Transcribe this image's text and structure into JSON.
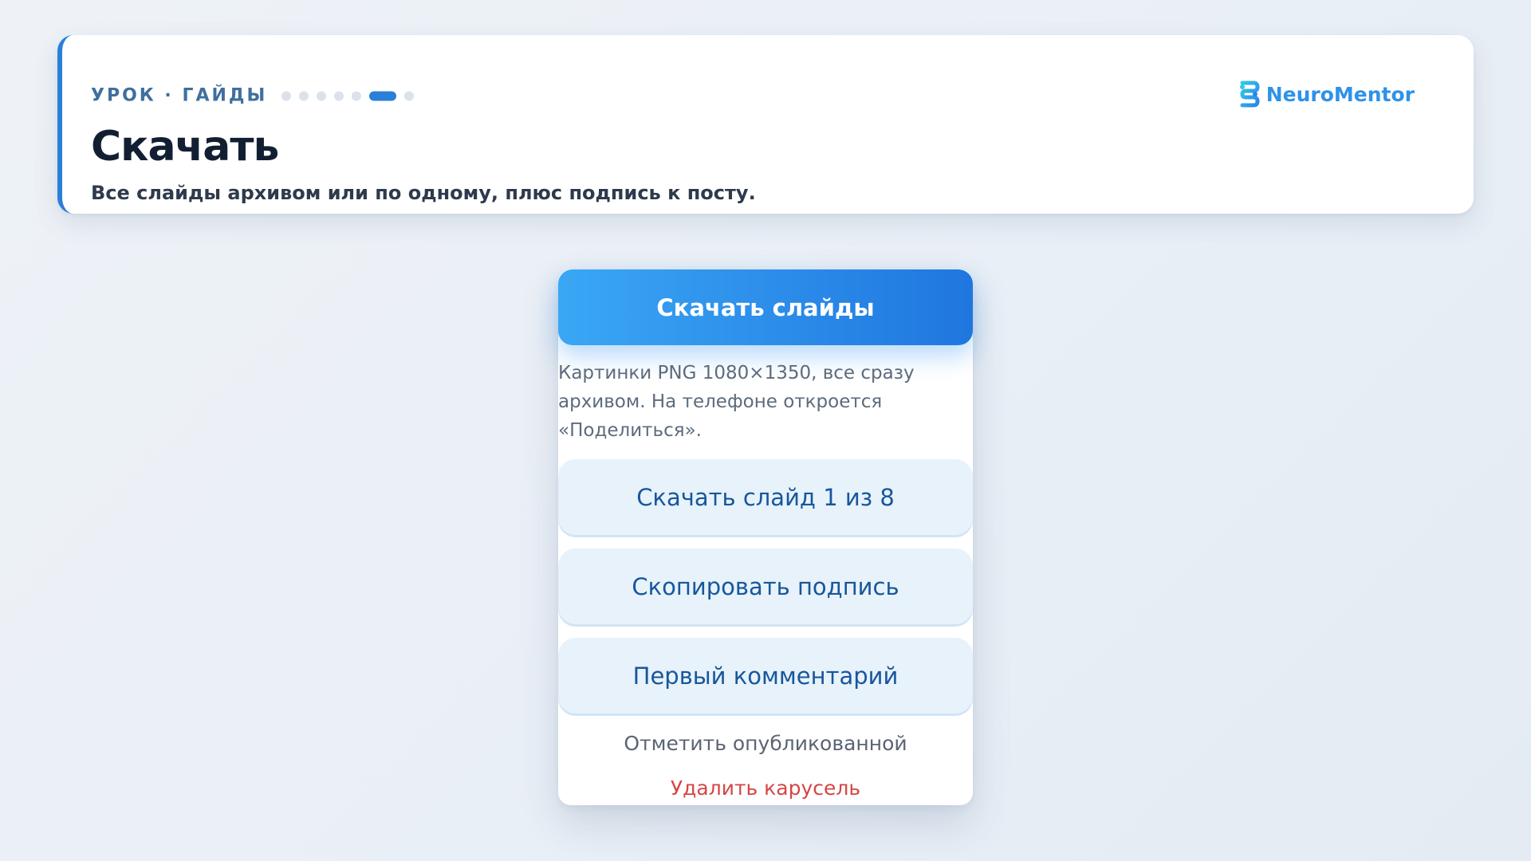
{
  "header": {
    "eyebrow": "УРОК · ГАЙДЫ",
    "progress": {
      "total_steps": 7,
      "current_step": 6
    },
    "title": "Скачать",
    "subtitle": "Все слайды архивом или по одному, плюс подпись к посту."
  },
  "brand": {
    "name": "NeuroMentor",
    "icon": "neuromentor-logo-icon",
    "color": "#2e92e8"
  },
  "actions": {
    "primary_label": "Скачать слайды",
    "hint": "Картинки PNG 1080×1350, все сразу архивом. На телефоне откроется «Поделиться».",
    "download_one_label": "Скачать слайд 1 из 8",
    "copy_caption_label": "Скопировать подпись",
    "first_comment_label": "Первый комментарий",
    "mark_published_label": "Отметить опубликованной",
    "delete_label": "Удалить карусель"
  },
  "colors": {
    "accent": "#2a7fd8",
    "primary_gradient_start": "#3aa7f5",
    "primary_gradient_end": "#1f76df",
    "secondary_bg": "#e8f2fb",
    "secondary_text": "#17579b",
    "danger": "#d64545"
  }
}
